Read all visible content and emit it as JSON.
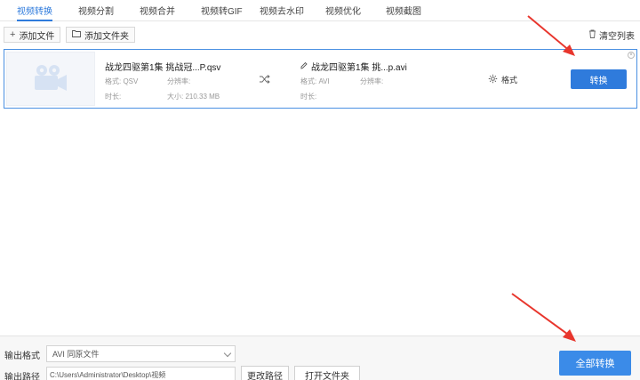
{
  "tabs": [
    {
      "label": "视频转换",
      "active": true
    },
    {
      "label": "视频分割"
    },
    {
      "label": "视频合并"
    },
    {
      "label": "视频转GIF"
    },
    {
      "label": "视频去水印"
    },
    {
      "label": "视频优化"
    },
    {
      "label": "视频截图"
    }
  ],
  "toolbar": {
    "add_file": "添加文件",
    "add_folder": "添加文件夹",
    "clear_list": "清空列表"
  },
  "file": {
    "source_name": "战龙四驱第1集 挑战冠...P.qsv",
    "source_format": "格式: QSV",
    "source_resolution": "分辨率:",
    "source_duration": "时长:",
    "source_size": "大小:   210.33 MB",
    "target_name": "战龙四驱第1集 挑...p.avi",
    "target_format": "格式: AVI",
    "target_resolution": "分辨率:",
    "target_duration": "时长:",
    "format_label": "格式",
    "convert_label": "转换"
  },
  "bottom": {
    "output_format_label": "输出格式",
    "output_format_value": "AVI  同原文件",
    "output_path_label": "输出路径",
    "output_path_value": "C:\\Users\\Administrator\\Desktop\\视频",
    "change_path": "更改路径",
    "open_folder": "打开文件夹",
    "convert_all": "全部转换"
  },
  "colors": {
    "accent": "#2f7bdc",
    "annotation_arrow": "#e8362d"
  }
}
